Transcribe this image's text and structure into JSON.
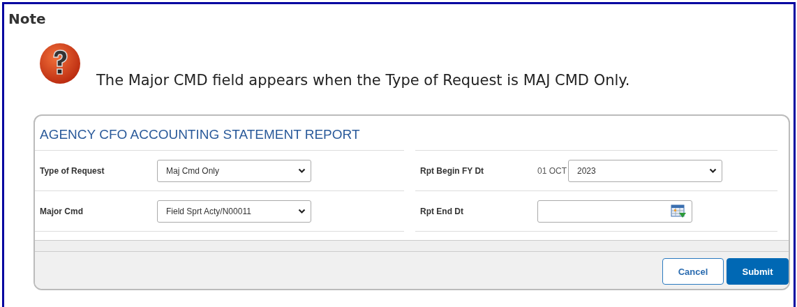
{
  "note": {
    "heading": "Note",
    "text": "The Major CMD field appears when the Type of Request is MAJ CMD Only."
  },
  "form": {
    "title": "AGENCY CFO ACCOUNTING STATEMENT REPORT",
    "left_fields": [
      {
        "label": "Type of Request",
        "kind": "select",
        "value": "Maj Cmd Only"
      },
      {
        "label": "Major Cmd",
        "kind": "select",
        "value": "Field Sprt Acty/N00011"
      }
    ],
    "right_fields": [
      {
        "label": "Rpt Begin FY Dt",
        "kind": "prefixed-select",
        "prefix": "01 OCT",
        "value": "2023"
      },
      {
        "label": "Rpt End Dt",
        "kind": "date"
      }
    ],
    "buttons": [
      {
        "label": "Cancel",
        "kind": "secondary"
      },
      {
        "label": "Submit",
        "kind": "primary"
      }
    ]
  }
}
